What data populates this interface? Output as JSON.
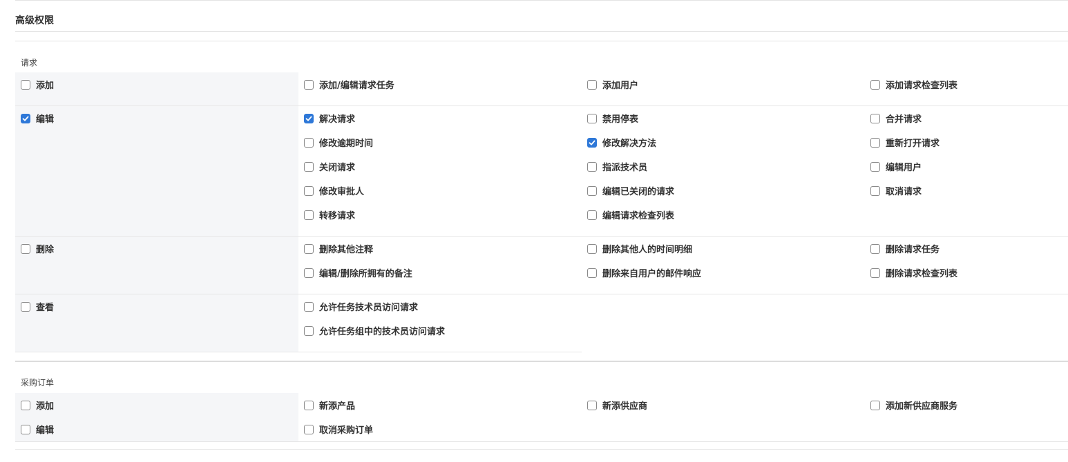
{
  "heading": "高级权限",
  "requests": {
    "title": "请求",
    "rows": [
      {
        "main": {
          "label": "添加",
          "checked": false
        },
        "cols": [
          [
            {
              "label": "添加/编辑请求任务",
              "checked": false
            }
          ],
          [
            {
              "label": "添加用户",
              "checked": false
            }
          ],
          [
            {
              "label": "添加请求检查列表",
              "checked": false
            }
          ]
        ]
      },
      {
        "main": {
          "label": "编辑",
          "checked": true
        },
        "cols": [
          [
            {
              "label": "解决请求",
              "checked": true
            },
            {
              "label": "修改逾期时间",
              "checked": false
            },
            {
              "label": "关闭请求",
              "checked": false
            },
            {
              "label": "修改审批人",
              "checked": false
            },
            {
              "label": "转移请求",
              "checked": false
            }
          ],
          [
            {
              "label": "禁用停表",
              "checked": false
            },
            {
              "label": "修改解决方法",
              "checked": true
            },
            {
              "label": "指派技术员",
              "checked": false
            },
            {
              "label": "编辑已关闭的请求",
              "checked": false
            },
            {
              "label": "编辑请求检查列表",
              "checked": false
            }
          ],
          [
            {
              "label": "合并请求",
              "checked": false
            },
            {
              "label": "重新打开请求",
              "checked": false
            },
            {
              "label": "编辑用户",
              "checked": false
            },
            {
              "label": "取消请求",
              "checked": false
            }
          ]
        ]
      },
      {
        "main": {
          "label": "删除",
          "checked": false
        },
        "cols": [
          [
            {
              "label": "删除其他注释",
              "checked": false
            },
            {
              "label": "编辑/删除所拥有的备注",
              "checked": false
            }
          ],
          [
            {
              "label": "删除其他人的时间明细",
              "checked": false
            },
            {
              "label": "删除来自用户的邮件响应",
              "checked": false
            }
          ],
          [
            {
              "label": "删除请求任务",
              "checked": false
            },
            {
              "label": "删除请求检查列表",
              "checked": false
            }
          ]
        ]
      },
      {
        "main": {
          "label": "查看",
          "checked": false
        },
        "cols": [
          [
            {
              "label": "允许任务技术员访问请求",
              "checked": false
            },
            {
              "label": "允许任务组中的技术员访问请求",
              "checked": false
            }
          ],
          [],
          []
        ]
      }
    ]
  },
  "purchase_orders": {
    "title": "采购订单",
    "rows": [
      {
        "main": {
          "label": "添加",
          "checked": false
        },
        "cols": [
          [
            {
              "label": "新添产品",
              "checked": false
            }
          ],
          [
            {
              "label": "新添供应商",
              "checked": false
            }
          ],
          [
            {
              "label": "添加新供应商服务",
              "checked": false
            }
          ]
        ]
      },
      {
        "main": {
          "label": "编辑",
          "checked": false
        },
        "cols": [
          [
            {
              "label": "取消采购订单",
              "checked": false
            }
          ],
          [],
          []
        ]
      }
    ]
  }
}
